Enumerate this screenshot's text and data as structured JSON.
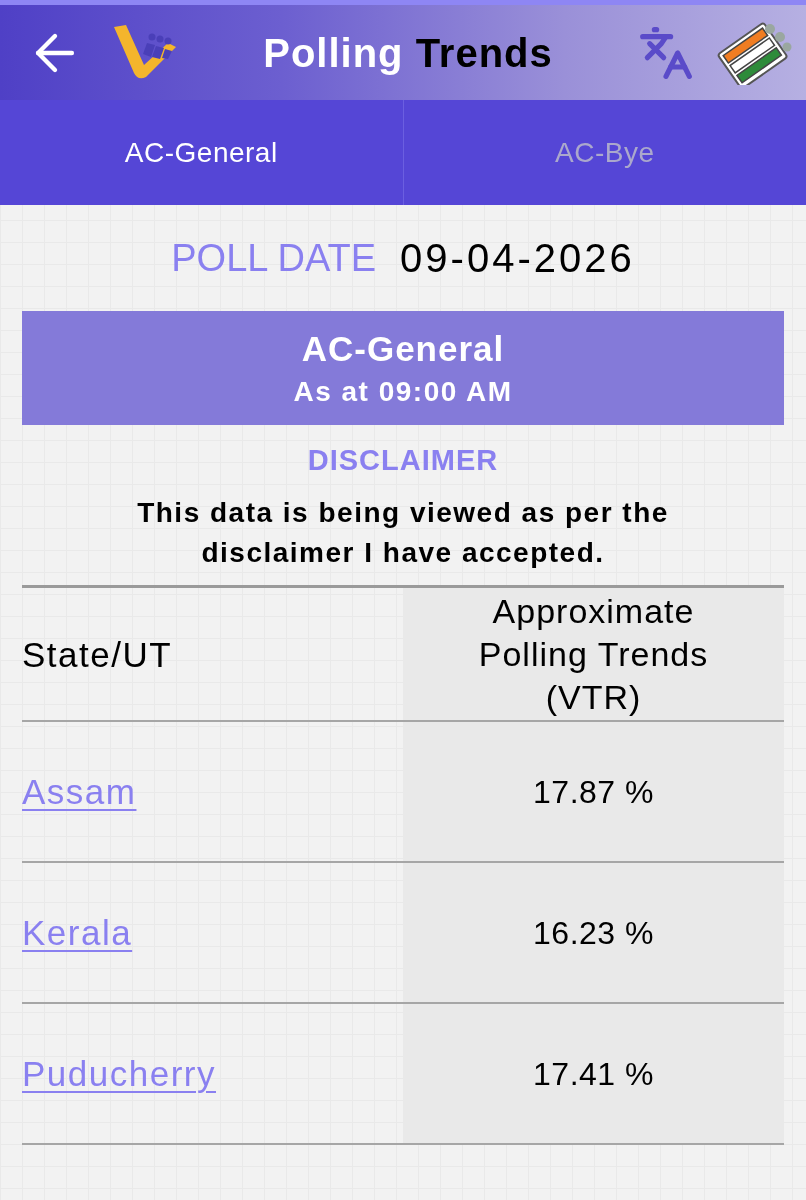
{
  "header": {
    "title": "Polling Trends"
  },
  "tabs": [
    {
      "label": "AC-General",
      "selected": true
    },
    {
      "label": "AC-Bye",
      "selected": false
    }
  ],
  "poll_date": {
    "label": "POLL DATE",
    "value": "09-04-2026"
  },
  "banner": {
    "title": "AC-General",
    "subtitle": "As at 09:00 AM"
  },
  "disclaimer": {
    "heading": "DISCLAIMER",
    "text": "This data is being viewed as per the disclaimer I have accepted."
  },
  "table": {
    "columns": [
      "State/UT",
      "Approximate Polling Trends (VTR)"
    ],
    "rows": [
      {
        "state": "Assam",
        "trend": "17.87 %"
      },
      {
        "state": "Kerala",
        "trend": "16.23 %"
      },
      {
        "state": "Puducherry",
        "trend": "17.41 %"
      }
    ]
  }
}
